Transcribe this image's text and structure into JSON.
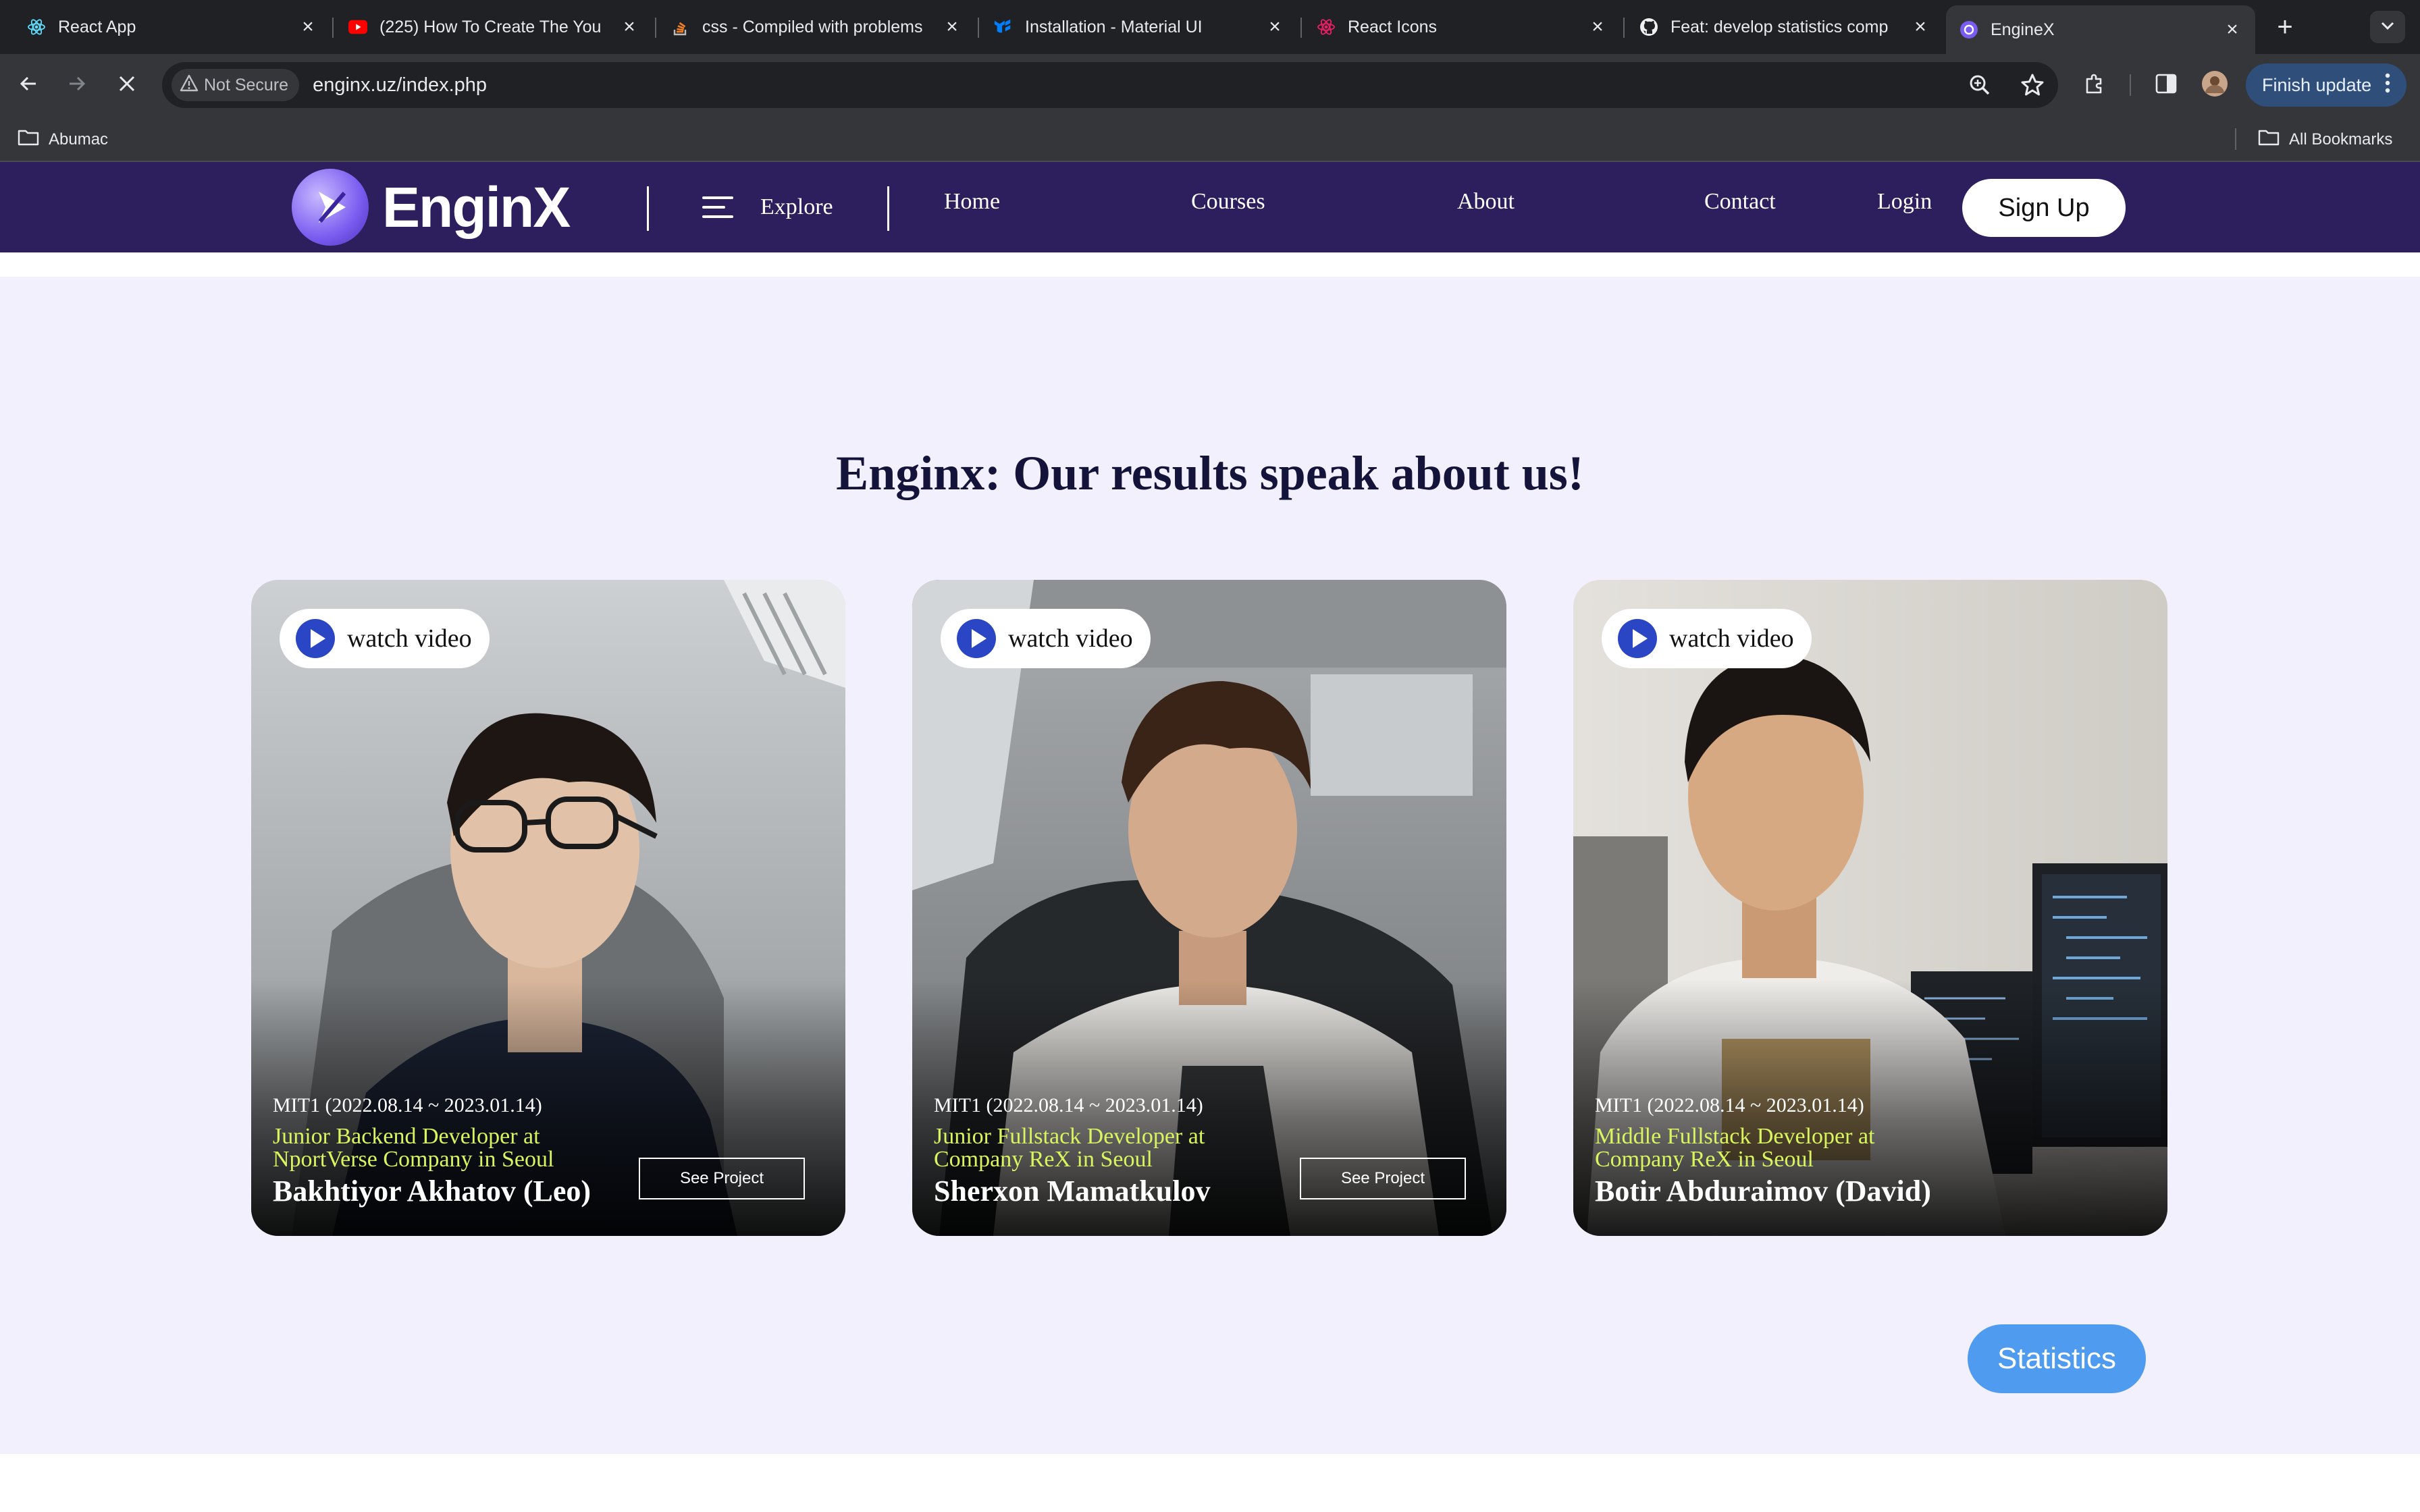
{
  "browser": {
    "tabs": [
      {
        "title": "React App",
        "icon": "react-icon"
      },
      {
        "title": "(225) How To Create The You",
        "icon": "youtube-icon"
      },
      {
        "title": "css - Compiled with problems",
        "icon": "stackoverflow-icon"
      },
      {
        "title": "Installation - Material UI",
        "icon": "mui-icon"
      },
      {
        "title": "React Icons",
        "icon": "react-icons-icon"
      },
      {
        "title": "Feat: develop statistics comp",
        "icon": "github-icon"
      },
      {
        "title": "EngineX",
        "icon": "enginex-icon",
        "active": true
      }
    ],
    "security_label": "Not Secure",
    "url": "enginx.uz/index.php",
    "finish_update_label": "Finish update",
    "bookmarks": {
      "left": "Abumac",
      "right": "All Bookmarks"
    }
  },
  "site": {
    "logo_text": "EnginX",
    "nav": {
      "explore": "Explore",
      "home": "Home",
      "courses": "Courses",
      "about": "About",
      "contact": "Contact",
      "login": "Login",
      "signup": "Sign Up"
    },
    "headline": "Enginx: Our results speak about us!",
    "watch_label": "watch video",
    "see_project_label": "See Project",
    "cards": [
      {
        "cohort": "MIT1 (2022.08.14 ~ 2023.01.14)",
        "role": "Junior Backend Developer at NportVerse Company in Seoul",
        "name": "Bakhtiyor Akhatov (Leo)"
      },
      {
        "cohort": "MIT1 (2022.08.14 ~ 2023.01.14)",
        "role": "Junior Fullstack Developer at Company ReX in Seoul",
        "name": "Sherxon Mamatkulov"
      },
      {
        "cohort": "MIT1 (2022.08.14 ~ 2023.01.14)",
        "role": "Middle Fullstack Developer at Company ReX in Seoul",
        "name": "Botir Abduraimov (David)"
      }
    ],
    "statistics_label": "Statistics"
  },
  "colors": {
    "header_bg": "#2d1f5e",
    "section_bg": "#f2f0fd",
    "headline": "#14143a",
    "role_text": "#d8f560",
    "play_button": "#2b46c4",
    "statistics_button": "#4f9bef"
  }
}
